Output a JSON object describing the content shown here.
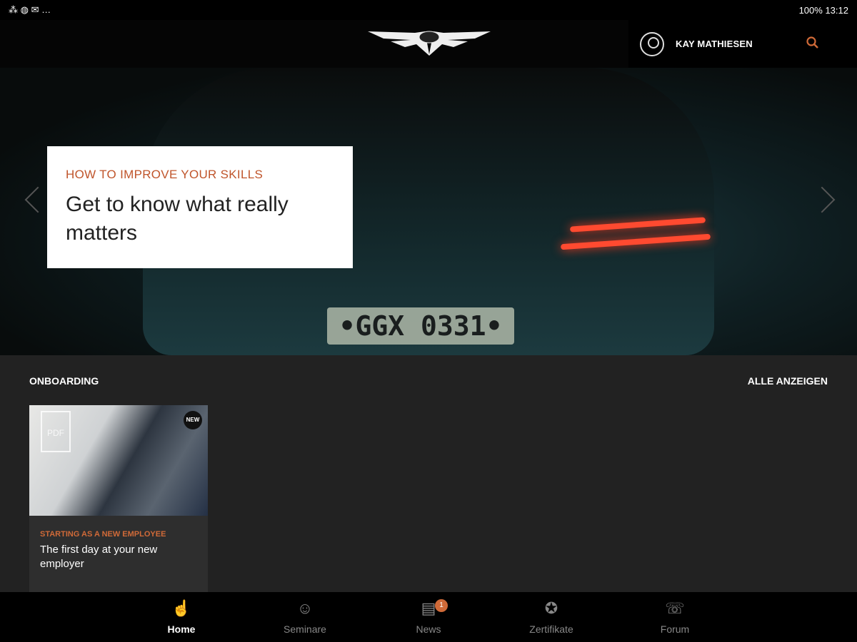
{
  "status_bar": {
    "left_icons": "⁂ ◍ ✉ …",
    "battery": "100%",
    "time": "13:12"
  },
  "header": {
    "logo": "GENESIS",
    "user_name": "KAY MATHIESEN",
    "search_icon": "search-icon"
  },
  "hero": {
    "kicker": "HOW TO IMPROVE YOUR SKILLS",
    "title": "Get to know what really matters",
    "plate": "•GGX 0331•"
  },
  "section": {
    "title": "ONBOARDING",
    "show_all": "ALLE ANZEIGEN"
  },
  "tiles": [
    {
      "kicker": "STARTING AS A NEW EMPLOYEE",
      "title": "The first day at your new employer",
      "file_type": "PDF",
      "badge": "NEW"
    }
  ],
  "nav": [
    {
      "label": "Home",
      "icon": "home-icon",
      "active": true
    },
    {
      "label": "Seminare",
      "icon": "seminar-icon"
    },
    {
      "label": "News",
      "icon": "news-icon",
      "badge": "1"
    },
    {
      "label": "Zertifikate",
      "icon": "certificate-icon"
    },
    {
      "label": "Forum",
      "icon": "forum-icon"
    }
  ],
  "colors": {
    "accent": "#d06a38",
    "background": "#222222"
  }
}
